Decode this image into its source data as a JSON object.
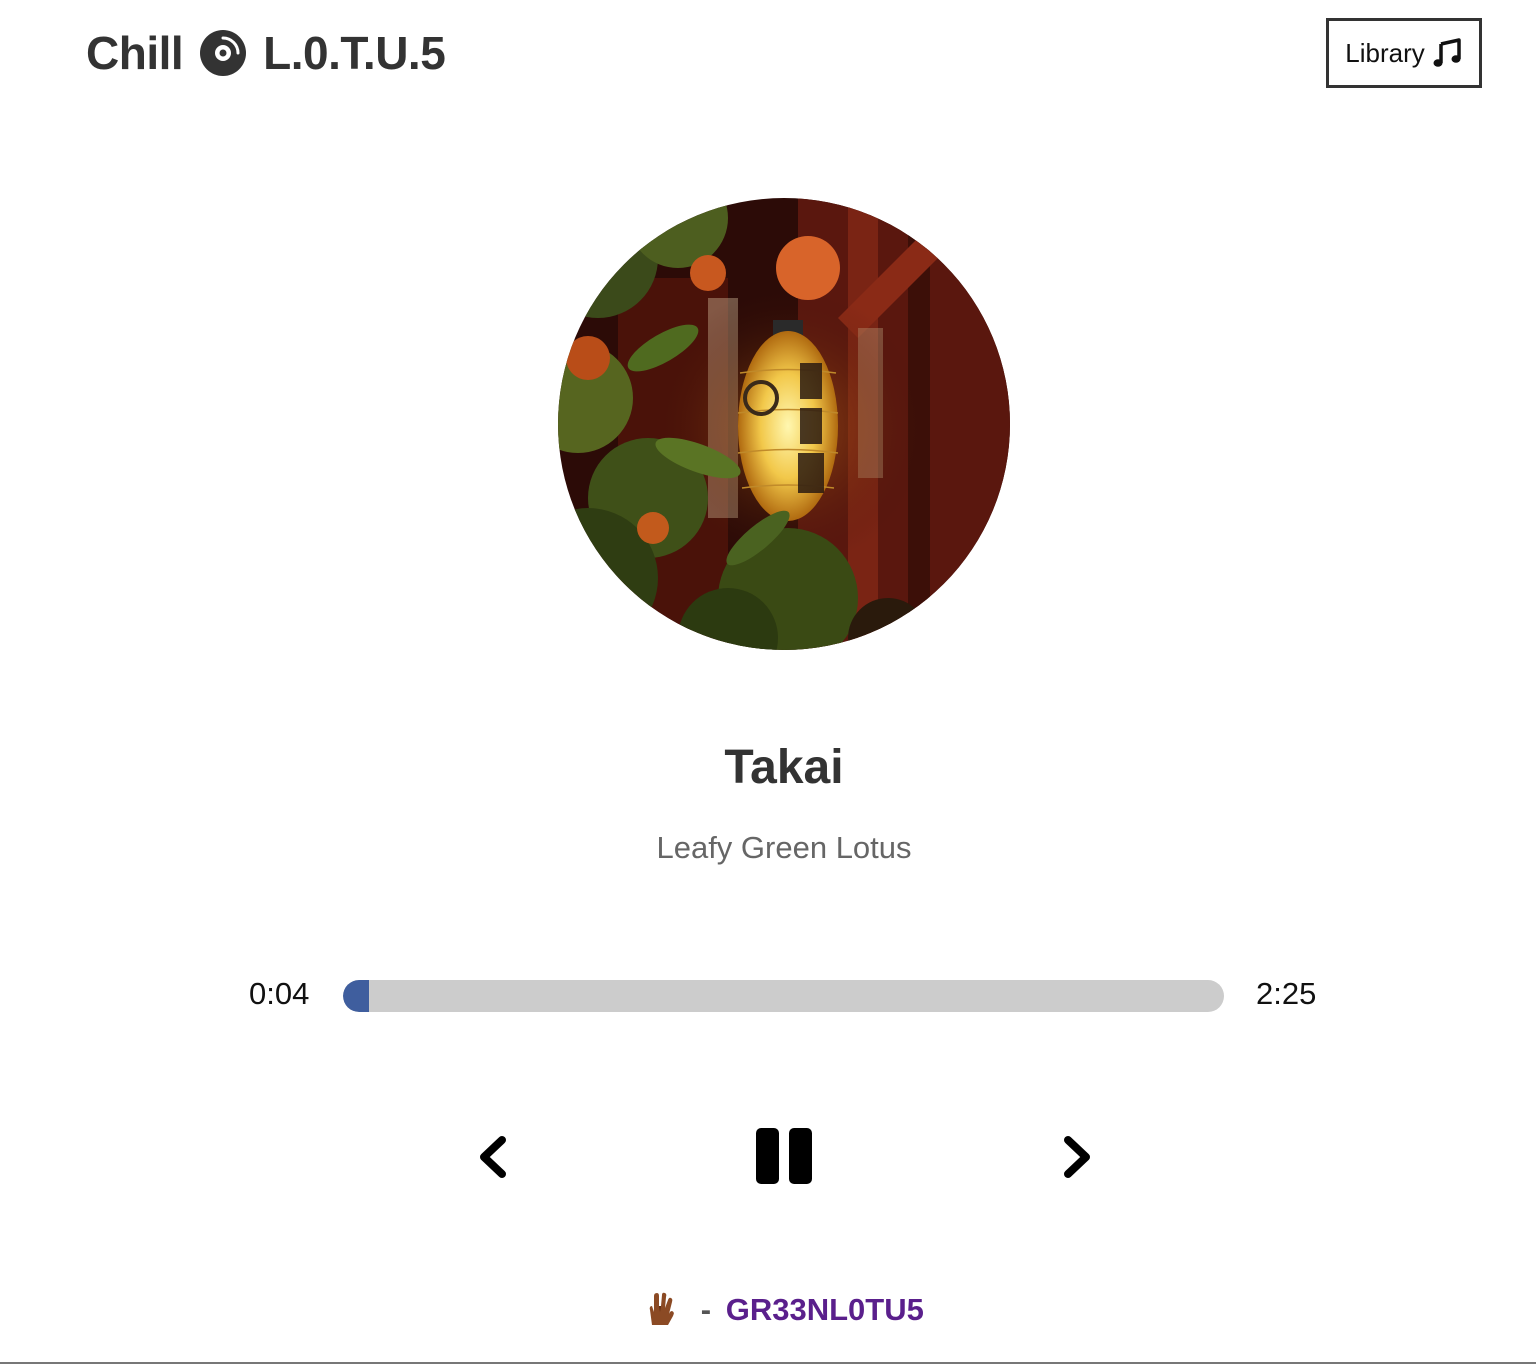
{
  "header": {
    "brand_left": "Chill",
    "brand_icon": "vinyl-disc-icon",
    "brand_right": "L.0.T.U.5",
    "library_label": "Library",
    "library_icon": "music-note-icon"
  },
  "player": {
    "cover_icon": "album-art-lantern",
    "title": "Takai",
    "artist": "Leafy Green Lotus",
    "current_time": "0:04",
    "total_time": "2:25",
    "progress_fraction": 0.03,
    "controls": {
      "prev_icon": "chevron-left-icon",
      "pause_icon": "pause-icon",
      "next_icon": "chevron-right-icon"
    }
  },
  "footer": {
    "emoji_icon": "vulcan-salute-icon",
    "separator": "-",
    "credit": "GR33NL0TU5"
  },
  "colors": {
    "text": "#333333",
    "accent_progress": "#3f5e9e",
    "progress_track": "#cccccc",
    "credit": "#5a1f8c"
  }
}
